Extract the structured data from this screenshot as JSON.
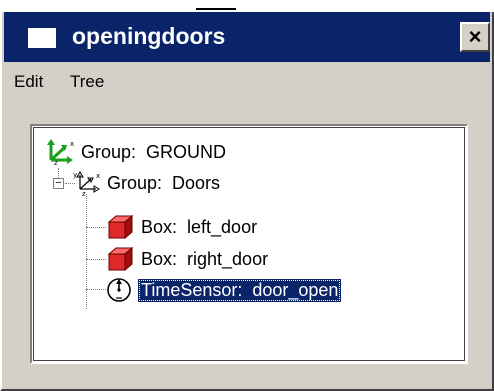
{
  "window": {
    "title": "openingdoors",
    "close_label": "×"
  },
  "menu": {
    "items": [
      {
        "label": "Edit"
      },
      {
        "label": "Tree"
      }
    ]
  },
  "tree": {
    "nodes": [
      {
        "label": "Group:  GROUND",
        "icon": "group-root-icon",
        "selected": false
      },
      {
        "label": "Group:  Doors",
        "icon": "group-icon",
        "selected": false,
        "expanded": true
      },
      {
        "label": "Box:  left_door",
        "icon": "box-icon",
        "selected": false
      },
      {
        "label": "Box:  right_door",
        "icon": "box-icon",
        "selected": false
      },
      {
        "label": "TimeSensor:  door_open",
        "icon": "timesensor-icon",
        "selected": true
      }
    ],
    "expander_symbol": "−"
  },
  "colors": {
    "titlebar": "#0a246a",
    "window_face": "#d4d0c8",
    "selection": "#0a246a",
    "box_red": "#e0282a",
    "root_green": "#1aa01a"
  }
}
